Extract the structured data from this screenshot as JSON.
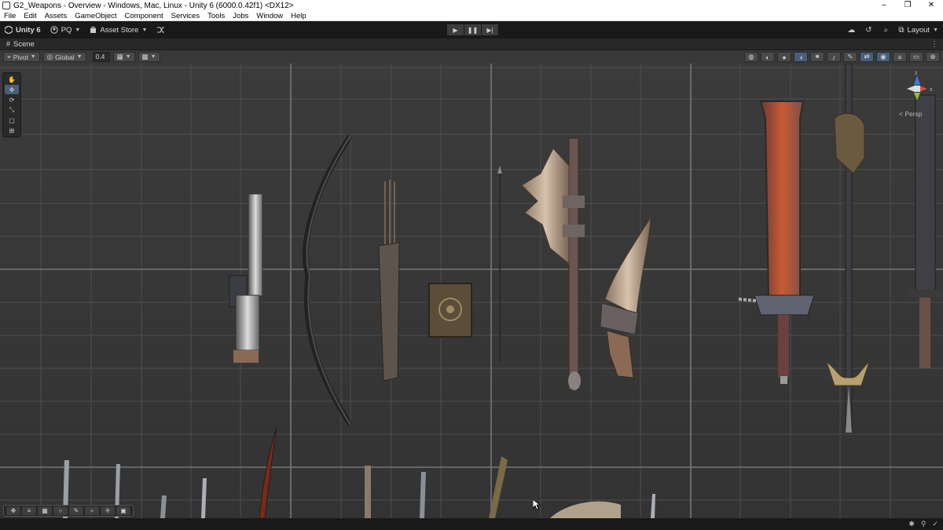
{
  "window": {
    "title": "G2_Weapons - Overview - Windows, Mac, Linux - Unity 6 (6000.0.42f1) <DX12>",
    "controls": [
      "–",
      "❐",
      "✕"
    ]
  },
  "menu": [
    "File",
    "Edit",
    "Assets",
    "GameObject",
    "Component",
    "Services",
    "Tools",
    "Jobs",
    "Window",
    "Help"
  ],
  "toolbar": {
    "unity_label": "Unity 6",
    "account_label": "PQ",
    "asset_store_label": "Asset Store",
    "layout_label": "Layout"
  },
  "scene_tab": {
    "label": "Scene"
  },
  "scene_toolbar": {
    "pivot_label": "Pivot",
    "global_label": "Global",
    "snap_value": "0.4"
  },
  "gizmo": {
    "persp_label": "Persp",
    "axis_z": "z",
    "axis_x": "x"
  },
  "colors": {
    "viewport_bg": "#3a3a3a",
    "grid_line": "#555555",
    "accent": "#46607c",
    "gizmo_y": "#8fbf3f",
    "gizmo_x": "#e04a3a",
    "gizmo_z": "#3f7be0"
  },
  "icons": {
    "tools": [
      "hand-icon",
      "move-icon",
      "rotate-icon",
      "scale-icon",
      "rect-icon",
      "transform-icon"
    ],
    "bottom_overlay": [
      "move-icon",
      "settings-icon",
      "grid-icon",
      "circle-icon",
      "light-icon",
      "search-icon",
      "snap-icon",
      "camera-icon"
    ]
  }
}
